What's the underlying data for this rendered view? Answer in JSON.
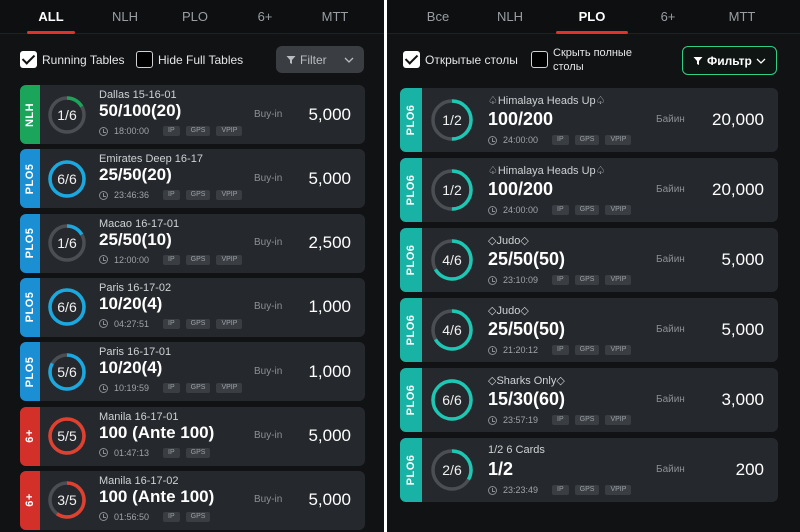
{
  "left": {
    "tabs": [
      {
        "label": "ALL",
        "active": true
      },
      {
        "label": "NLH",
        "active": false
      },
      {
        "label": "PLO",
        "active": false
      },
      {
        "label": "6+",
        "active": false
      },
      {
        "label": "MTT",
        "active": false
      }
    ],
    "filters": {
      "running_label": "Running Tables",
      "running_checked": true,
      "hide_full_label": "Hide Full Tables",
      "hide_full_checked": false,
      "filter_label": "Filter"
    },
    "rows": [
      {
        "game": "NLH",
        "badge_color": "#1aa55a",
        "ring_color": "#1aa55a",
        "seats": "1/6",
        "fill": 0.1667,
        "name": "Dallas 15-16-01",
        "stakes": "50/100(20)",
        "timer": "18:00:00",
        "tags": [
          "IP",
          "GPS",
          "VPIP"
        ],
        "buyin_label": "Buy-in",
        "amount": "5,000"
      },
      {
        "game": "PLO5",
        "badge_color": "#1a8fd4",
        "ring_color": "#1aa8e0",
        "seats": "6/6",
        "fill": 1.0,
        "name": "Emirates Deep 16-17",
        "stakes": "25/50(20)",
        "timer": "23:46:36",
        "tags": [
          "IP",
          "GPS",
          "VPIP"
        ],
        "buyin_label": "Buy-in",
        "amount": "5,000"
      },
      {
        "game": "PLO5",
        "badge_color": "#1a8fd4",
        "ring_color": "#1aa8e0",
        "seats": "1/6",
        "fill": 0.1667,
        "name": "Macao 16-17-01",
        "stakes": "25/50(10)",
        "timer": "12:00:00",
        "tags": [
          "IP",
          "GPS",
          "VPIP"
        ],
        "buyin_label": "Buy-in",
        "amount": "2,500"
      },
      {
        "game": "PLO5",
        "badge_color": "#1a8fd4",
        "ring_color": "#1aa8e0",
        "seats": "6/6",
        "fill": 1.0,
        "name": "Paris 16-17-02",
        "stakes": "10/20(4)",
        "timer": "04:27:51",
        "tags": [
          "IP",
          "GPS",
          "VPIP"
        ],
        "buyin_label": "Buy-in",
        "amount": "1,000"
      },
      {
        "game": "PLO5",
        "badge_color": "#1a8fd4",
        "ring_color": "#1aa8e0",
        "seats": "5/6",
        "fill": 0.8333,
        "name": "Paris 16-17-01",
        "stakes": "10/20(4)",
        "timer": "10:19:59",
        "tags": [
          "IP",
          "GPS",
          "VPIP"
        ],
        "buyin_label": "Buy-in",
        "amount": "1,000"
      },
      {
        "game": "6+",
        "badge_color": "#d4302a",
        "ring_color": "#e0402f",
        "seats": "5/5",
        "fill": 1.0,
        "name": "Manila 16-17-01",
        "stakes": "100 (Ante 100)",
        "timer": "01:47:13",
        "tags": [
          "IP",
          "GPS"
        ],
        "buyin_label": "Buy-in",
        "amount": "5,000"
      },
      {
        "game": "6+",
        "badge_color": "#d4302a",
        "ring_color": "#e0402f",
        "seats": "3/5",
        "fill": 0.6,
        "name": "Manila 16-17-02",
        "stakes": "100 (Ante 100)",
        "timer": "01:56:50",
        "tags": [
          "IP",
          "GPS"
        ],
        "buyin_label": "Buy-in",
        "amount": "5,000"
      }
    ]
  },
  "right": {
    "tabs": [
      {
        "label": "Все",
        "active": false
      },
      {
        "label": "NLH",
        "active": false
      },
      {
        "label": "PLO",
        "active": true
      },
      {
        "label": "6+",
        "active": false
      },
      {
        "label": "MTT",
        "active": false
      }
    ],
    "filters": {
      "running_label": "Открытые столы",
      "running_checked": true,
      "hide_full_label_1": "Скрыть полные",
      "hide_full_label_2": "столы",
      "hide_full_checked": false,
      "filter_label": "Фильтр"
    },
    "rows": [
      {
        "game": "PLO6",
        "badge_color": "#18b3a4",
        "ring_color": "#1cc7b4",
        "seats": "1/2",
        "fill": 0.5,
        "name": "♤Himalaya Heads Up♤",
        "stakes": "100/200",
        "timer": "24:00:00",
        "tags": [
          "IP",
          "GPS",
          "VPIP"
        ],
        "buyin_label": "Байин",
        "amount": "20,000"
      },
      {
        "game": "PLO6",
        "badge_color": "#18b3a4",
        "ring_color": "#1cc7b4",
        "seats": "1/2",
        "fill": 0.5,
        "name": "♤Himalaya Heads Up♤",
        "stakes": "100/200",
        "timer": "24:00:00",
        "tags": [
          "IP",
          "GPS",
          "VPIP"
        ],
        "buyin_label": "Байин",
        "amount": "20,000"
      },
      {
        "game": "PLO6",
        "badge_color": "#18b3a4",
        "ring_color": "#1cc7b4",
        "seats": "4/6",
        "fill": 0.6667,
        "name": "◇Judo◇",
        "stakes": "25/50(50)",
        "timer": "23:10:09",
        "tags": [
          "IP",
          "GPS",
          "VPIP"
        ],
        "buyin_label": "Байин",
        "amount": "5,000"
      },
      {
        "game": "PLO6",
        "badge_color": "#18b3a4",
        "ring_color": "#1cc7b4",
        "seats": "4/6",
        "fill": 0.6667,
        "name": "◇Judo◇",
        "stakes": "25/50(50)",
        "timer": "21:20:12",
        "tags": [
          "IP",
          "GPS",
          "VPIP"
        ],
        "buyin_label": "Байин",
        "amount": "5,000"
      },
      {
        "game": "PLO6",
        "badge_color": "#18b3a4",
        "ring_color": "#1cc7b4",
        "seats": "6/6",
        "fill": 1.0,
        "name": "◇Sharks Only◇",
        "stakes": "15/30(60)",
        "timer": "23:57:19",
        "tags": [
          "IP",
          "GPS",
          "VPIP"
        ],
        "buyin_label": "Байин",
        "amount": "3,000"
      },
      {
        "game": "PLO6",
        "badge_color": "#18b3a4",
        "ring_color": "#1cc7b4",
        "seats": "2/6",
        "fill": 0.3333,
        "name": "1/2 6 Cards",
        "stakes": "1/2",
        "timer": "23:23:49",
        "tags": [
          "IP",
          "GPS",
          "VPIP"
        ],
        "buyin_label": "Байин",
        "amount": "200"
      }
    ]
  }
}
